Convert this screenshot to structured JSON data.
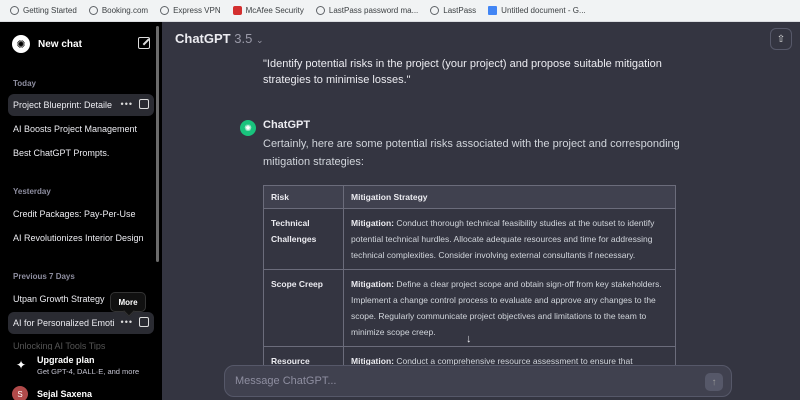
{
  "bookmarks": [
    {
      "label": "Getting Started",
      "icon": "globe-icon"
    },
    {
      "label": "Booking.com",
      "icon": "globe-icon"
    },
    {
      "label": "Express VPN",
      "icon": "globe-icon"
    },
    {
      "label": "McAfee Security",
      "icon": "mcafee-icon"
    },
    {
      "label": "LastPass password ma...",
      "icon": "globe-icon"
    },
    {
      "label": "LastPass",
      "icon": "globe-icon"
    },
    {
      "label": "Untitled document - G...",
      "icon": "docs-icon"
    }
  ],
  "sidebar": {
    "new_chat": "New chat",
    "sections": [
      {
        "label": "Today",
        "items": [
          "Project Blueprint: Detaile",
          "AI Boosts Project Management",
          "Best ChatGPT Prompts."
        ]
      },
      {
        "label": "Yesterday",
        "items": [
          "Credit Packages: Pay-Per-Use",
          "AI Revolutionizes Interior Design"
        ]
      },
      {
        "label": "Previous 7 Days",
        "items": [
          "Utpan Growth Strategy",
          "AI for Personalized Emoti"
        ]
      }
    ],
    "faded_item": "Unlocking AI Tools Tips",
    "tooltip": "More",
    "upgrade": {
      "title": "Upgrade plan",
      "subtitle": "Get GPT-4, DALL·E, and more"
    },
    "user": {
      "initial": "S",
      "name": "Sejal Saxena"
    }
  },
  "header": {
    "model": "ChatGPT",
    "version": "3.5"
  },
  "conversation": {
    "user_message": "\"Identify potential risks in the project (your project) and propose suitable mitigation strategies to minimise losses.\"",
    "assistant_name": "ChatGPT",
    "assistant_intro": "Certainly, here are some potential risks associated with the project and corresponding mitigation strategies:",
    "table": {
      "headers": [
        "Risk",
        "Mitigation Strategy"
      ],
      "rows": [
        {
          "risk": "Technical Challenges",
          "label": "Mitigation:",
          "text": " Conduct thorough technical feasibility studies at the outset to identify potential technical hurdles. Allocate adequate resources and time for addressing technical complexities. Consider involving external consultants if necessary."
        },
        {
          "risk": "Scope Creep",
          "label": "Mitigation:",
          "text": " Define a clear project scope and obtain sign-off from key stakeholders. Implement a change control process to evaluate and approve any changes to the scope. Regularly communicate project objectives and limitations to the team to minimize scope creep."
        },
        {
          "risk": "Resource",
          "label": "Mitigation:",
          "text": " Conduct a comprehensive resource assessment to ensure that"
        }
      ]
    }
  },
  "composer": {
    "placeholder": "Message ChatGPT..."
  }
}
